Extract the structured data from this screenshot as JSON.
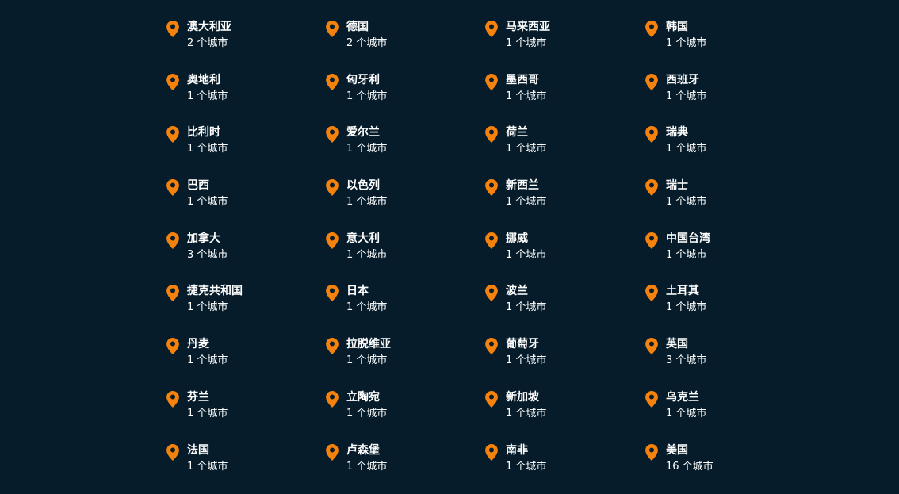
{
  "accent_color": "#f5820d",
  "background_color": "#061c2a",
  "pin_icon": "map-pin-icon",
  "locations": [
    {
      "country": "澳大利亚",
      "cities": "2 个城市"
    },
    {
      "country": "德国",
      "cities": "2 个城市"
    },
    {
      "country": "马来西亚",
      "cities": "1 个城市"
    },
    {
      "country": "韩国",
      "cities": "1 个城市"
    },
    {
      "country": "奥地利",
      "cities": "1 个城市"
    },
    {
      "country": "匈牙利",
      "cities": "1 个城市"
    },
    {
      "country": "墨西哥",
      "cities": "1 个城市"
    },
    {
      "country": "西班牙",
      "cities": "1 个城市"
    },
    {
      "country": "比利时",
      "cities": "1 个城市"
    },
    {
      "country": "爱尔兰",
      "cities": "1 个城市"
    },
    {
      "country": "荷兰",
      "cities": "1 个城市"
    },
    {
      "country": "瑞典",
      "cities": "1 个城市"
    },
    {
      "country": "巴西",
      "cities": "1 个城市"
    },
    {
      "country": "以色列",
      "cities": "1 个城市"
    },
    {
      "country": "新西兰",
      "cities": "1 个城市"
    },
    {
      "country": "瑞士",
      "cities": "1 个城市"
    },
    {
      "country": "加拿大",
      "cities": "3 个城市"
    },
    {
      "country": "意大利",
      "cities": "1 个城市"
    },
    {
      "country": "挪威",
      "cities": "1 个城市"
    },
    {
      "country": "中国台湾",
      "cities": "1 个城市"
    },
    {
      "country": "捷克共和国",
      "cities": "1 个城市"
    },
    {
      "country": "日本",
      "cities": "1 个城市"
    },
    {
      "country": "波兰",
      "cities": "1 个城市"
    },
    {
      "country": "土耳其",
      "cities": "1 个城市"
    },
    {
      "country": "丹麦",
      "cities": "1 个城市"
    },
    {
      "country": "拉脱维亚",
      "cities": "1 个城市"
    },
    {
      "country": "葡萄牙",
      "cities": "1 个城市"
    },
    {
      "country": "英国",
      "cities": "3 个城市"
    },
    {
      "country": "芬兰",
      "cities": "1 个城市"
    },
    {
      "country": "立陶宛",
      "cities": "1 个城市"
    },
    {
      "country": "新加坡",
      "cities": "1 个城市"
    },
    {
      "country": "乌克兰",
      "cities": "1 个城市"
    },
    {
      "country": "法国",
      "cities": "1 个城市"
    },
    {
      "country": "卢森堡",
      "cities": "1 个城市"
    },
    {
      "country": "南非",
      "cities": "1 个城市"
    },
    {
      "country": "美国",
      "cities": "16 个城市"
    }
  ]
}
